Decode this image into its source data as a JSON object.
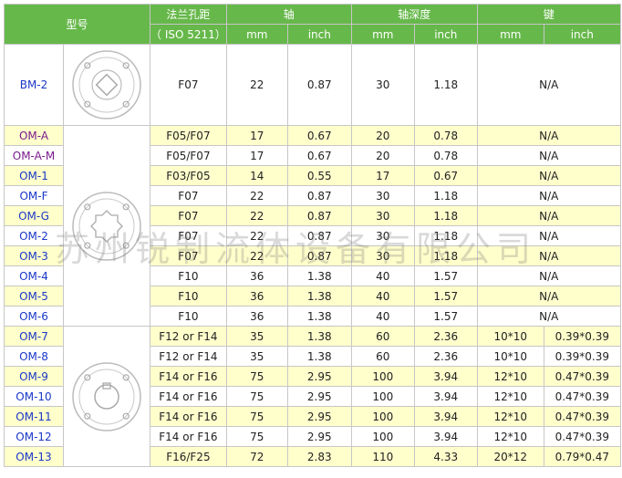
{
  "headers": {
    "model": "型号",
    "flange": "法兰孔距",
    "flange_std": "（ ISO 5211）",
    "shaft": "轴",
    "shaft_depth": "轴深度",
    "key": "键",
    "mm": "mm",
    "inch": "inch"
  },
  "watermark": "苏州锐制流体设备有限公司",
  "rows": [
    {
      "model": "BM-2",
      "flange": "F07",
      "shaft_mm": "22",
      "shaft_in": "0.87",
      "depth_mm": "30",
      "depth_in": "1.18",
      "key": "N/A"
    },
    {
      "model": "OM-A",
      "flange": "F05/F07",
      "shaft_mm": "17",
      "shaft_in": "0.67",
      "depth_mm": "20",
      "depth_in": "0.78",
      "key": "N/A"
    },
    {
      "model": "OM-A-M",
      "flange": "F05/F07",
      "shaft_mm": "17",
      "shaft_in": "0.67",
      "depth_mm": "20",
      "depth_in": "0.78",
      "key": "N/A"
    },
    {
      "model": "OM-1",
      "flange": "F03/F05",
      "shaft_mm": "14",
      "shaft_in": "0.55",
      "depth_mm": "17",
      "depth_in": "0.67",
      "key": "N/A"
    },
    {
      "model": "OM-F",
      "flange": "F07",
      "shaft_mm": "22",
      "shaft_in": "0.87",
      "depth_mm": "30",
      "depth_in": "1.18",
      "key": "N/A"
    },
    {
      "model": "OM-G",
      "flange": "F07",
      "shaft_mm": "22",
      "shaft_in": "0.87",
      "depth_mm": "30",
      "depth_in": "1.18",
      "key": "N/A"
    },
    {
      "model": "OM-2",
      "flange": "F07",
      "shaft_mm": "22",
      "shaft_in": "0.87",
      "depth_mm": "30",
      "depth_in": "1.18",
      "key": "N/A"
    },
    {
      "model": "OM-3",
      "flange": "F07",
      "shaft_mm": "22",
      "shaft_in": "0.87",
      "depth_mm": "30",
      "depth_in": "1.18",
      "key": "N/A"
    },
    {
      "model": "OM-4",
      "flange": "F10",
      "shaft_mm": "36",
      "shaft_in": "1.38",
      "depth_mm": "40",
      "depth_in": "1.57",
      "key": "N/A"
    },
    {
      "model": "OM-5",
      "flange": "F10",
      "shaft_mm": "36",
      "shaft_in": "1.38",
      "depth_mm": "40",
      "depth_in": "1.57",
      "key": "N/A"
    },
    {
      "model": "OM-6",
      "flange": "F10",
      "shaft_mm": "36",
      "shaft_in": "1.38",
      "depth_mm": "40",
      "depth_in": "1.57",
      "key": "N/A"
    },
    {
      "model": "OM-7",
      "flange": "F12 or F14",
      "shaft_mm": "35",
      "shaft_in": "1.38",
      "depth_mm": "60",
      "depth_in": "2.36",
      "key_mm": "10*10",
      "key_in": "0.39*0.39"
    },
    {
      "model": "OM-8",
      "flange": "F12 or F14",
      "shaft_mm": "35",
      "shaft_in": "1.38",
      "depth_mm": "60",
      "depth_in": "2.36",
      "key_mm": "10*10",
      "key_in": "0.39*0.39"
    },
    {
      "model": "OM-9",
      "flange": "F14 or F16",
      "shaft_mm": "75",
      "shaft_in": "2.95",
      "depth_mm": "100",
      "depth_in": "3.94",
      "key_mm": "12*10",
      "key_in": "0.47*0.39"
    },
    {
      "model": "OM-10",
      "flange": "F14 or F16",
      "shaft_mm": "75",
      "shaft_in": "2.95",
      "depth_mm": "100",
      "depth_in": "3.94",
      "key_mm": "12*10",
      "key_in": "0.47*0.39"
    },
    {
      "model": "OM-11",
      "flange": "F14 or F16",
      "shaft_mm": "75",
      "shaft_in": "2.95",
      "depth_mm": "100",
      "depth_in": "3.94",
      "key_mm": "12*10",
      "key_in": "0.47*0.39"
    },
    {
      "model": "OM-12",
      "flange": "F14 or F16",
      "shaft_mm": "75",
      "shaft_in": "2.95",
      "depth_mm": "100",
      "depth_in": "3.94",
      "key_mm": "12*10",
      "key_in": "0.47*0.39"
    },
    {
      "model": "OM-13",
      "flange": "F16/F25",
      "shaft_mm": "72",
      "shaft_in": "2.83",
      "depth_mm": "110",
      "depth_in": "4.33",
      "key_mm": "20*12",
      "key_in": "0.79*0.47"
    }
  ]
}
